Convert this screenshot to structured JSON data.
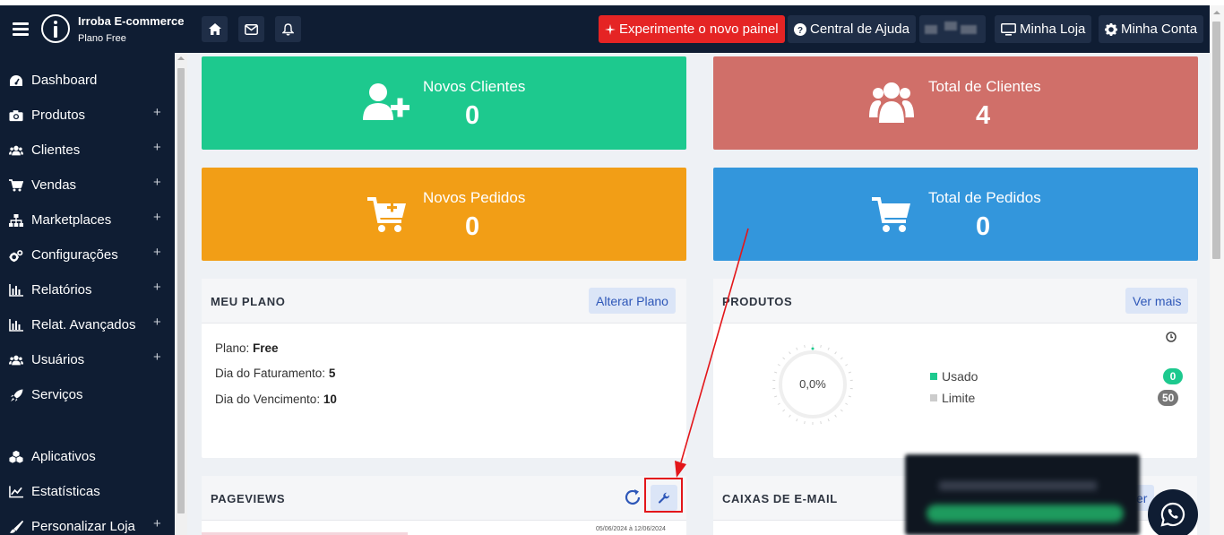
{
  "brand": {
    "name": "Irroba E-commerce",
    "plan": "Plano Free"
  },
  "topbar": {
    "new_panel_label": "Experimente o novo painel",
    "help_label": "Central de Ajuda",
    "store_label": "Minha Loja",
    "account_label": "Minha Conta"
  },
  "sidebar": {
    "items": [
      {
        "label": "Dashboard",
        "icon": "dashboard-icon",
        "expandable": false
      },
      {
        "label": "Produtos",
        "icon": "camera-icon",
        "expandable": true
      },
      {
        "label": "Clientes",
        "icon": "users-icon",
        "expandable": true
      },
      {
        "label": "Vendas",
        "icon": "cart-icon",
        "expandable": true
      },
      {
        "label": "Marketplaces",
        "icon": "sitemap-icon",
        "expandable": true
      },
      {
        "label": "Configurações",
        "icon": "cogs-icon",
        "expandable": true
      },
      {
        "label": "Relatórios",
        "icon": "bar-chart-icon",
        "expandable": true
      },
      {
        "label": "Relat. Avançados",
        "icon": "bar-chart-icon",
        "expandable": true
      },
      {
        "label": "Usuários",
        "icon": "users-icon",
        "expandable": true
      },
      {
        "label": "Serviços",
        "icon": "rocket-icon",
        "expandable": false
      },
      {
        "label": "Aplicativos",
        "icon": "cubes-icon",
        "expandable": false
      },
      {
        "label": "Estatísticas",
        "icon": "line-chart-icon",
        "expandable": false
      },
      {
        "label": "Personalizar Loja",
        "icon": "brush-icon",
        "expandable": true
      }
    ],
    "plus": "+"
  },
  "stats": {
    "new_clients": {
      "title": "Novos Clientes",
      "value": "0",
      "color": "#1dc98e"
    },
    "total_clients": {
      "title": "Total de Clientes",
      "value": "4",
      "color": "#d06f69"
    },
    "new_orders": {
      "title": "Novos Pedidos",
      "value": "0",
      "color": "#f29e16"
    },
    "total_orders": {
      "title": "Total de Pedidos",
      "value": "0",
      "color": "#3396dc"
    }
  },
  "my_plan": {
    "title": "MEU PLANO",
    "button": "Alterar Plano",
    "plan_label": "Plano: ",
    "plan_value": "Free",
    "billing_label": "Dia do Faturamento: ",
    "billing_value": "5",
    "due_label": "Dia do Vencimento: ",
    "due_value": "10"
  },
  "products": {
    "title": "PRODUTOS",
    "button": "Ver mais",
    "gauge_text": "0,0%",
    "gauge_fraction": 0.0,
    "used_label": "Usado",
    "used_value": "0",
    "limit_label": "Limite",
    "limit_value": "50",
    "used_color": "#1dc98e",
    "limit_color": "#cccccc"
  },
  "pageviews": {
    "title": "PAGEVIEWS",
    "date_range": "05/06/2024 à 12/06/2024"
  },
  "email_boxes": {
    "title": "CAIXAS DE E-MAIL",
    "button_partial": "er"
  }
}
